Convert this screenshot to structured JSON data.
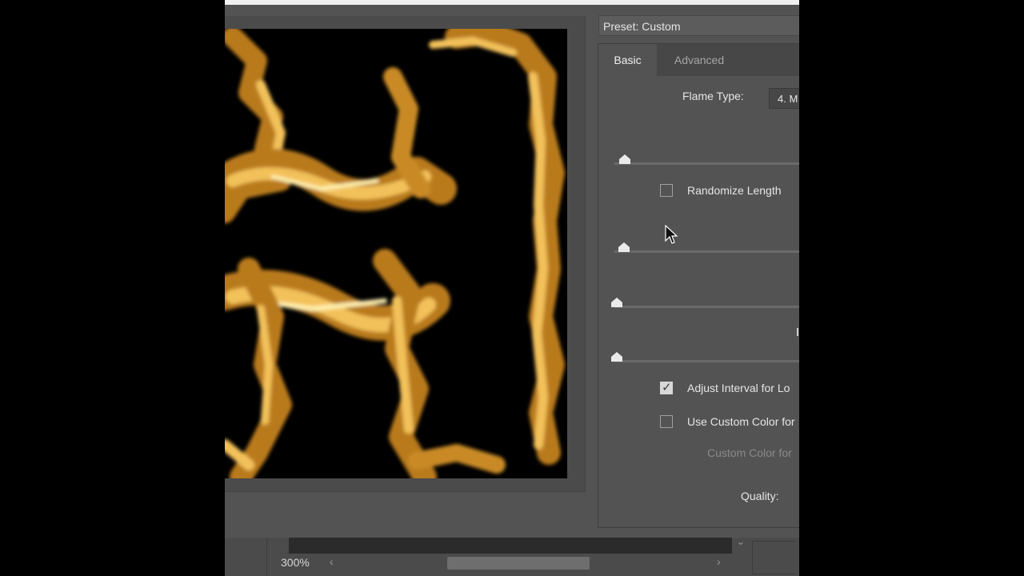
{
  "preset": {
    "label": "Preset: Custom"
  },
  "tabs": {
    "basic": "Basic",
    "advanced": "Advanced"
  },
  "flame_type": {
    "label": "Flame Type:",
    "value": "4. M"
  },
  "checkboxes": {
    "randomize_length": {
      "label": "Randomize Length",
      "checked": false
    },
    "adjust_interval": {
      "label": "Adjust Interval for Lo",
      "checked": true
    },
    "use_custom_color": {
      "label": "Use Custom Color for",
      "checked": false
    }
  },
  "custom_color_label": "Custom Color for",
  "quality_label": "Quality:",
  "zoom": {
    "level": "300%"
  },
  "icons": {
    "scroll_left": "‹",
    "scroll_right": "›",
    "dropdown": "⌄"
  },
  "colors": {
    "flame": "#f3c15a",
    "flame_core": "#fff1b0",
    "canvas": "#000000",
    "dialog_bg": "#535353"
  }
}
